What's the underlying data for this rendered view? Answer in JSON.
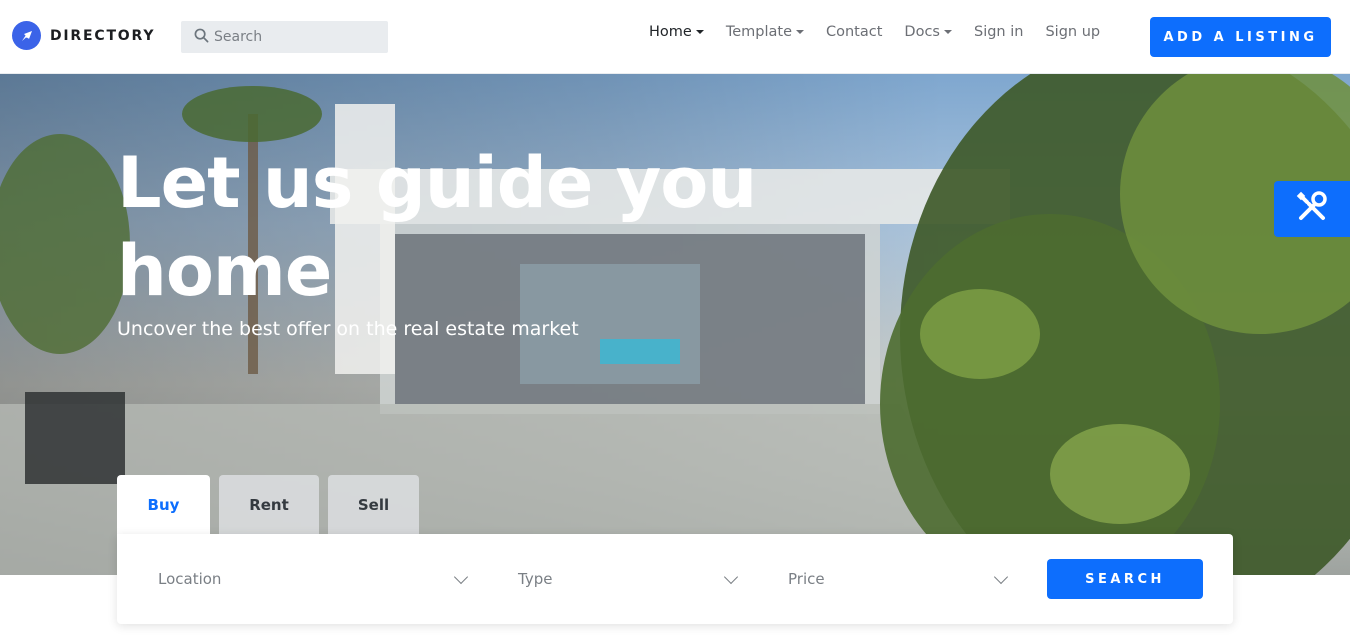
{
  "brand": {
    "name": "DIRECTORY",
    "icon": "compass-icon"
  },
  "search": {
    "placeholder": "Search",
    "icon": "search-icon"
  },
  "nav": {
    "items": [
      {
        "label": "Home",
        "dropdown": true,
        "active": true
      },
      {
        "label": "Template",
        "dropdown": true
      },
      {
        "label": "Contact",
        "dropdown": false
      },
      {
        "label": "Docs",
        "dropdown": true
      },
      {
        "label": "Sign in",
        "dropdown": false
      },
      {
        "label": "Sign up",
        "dropdown": false
      }
    ],
    "cta": "ADD A LISTING"
  },
  "hero": {
    "title": "Let us guide you home",
    "subtitle": "Uncover the best offer on the real estate market"
  },
  "tools": {
    "icon": "tools-icon"
  },
  "tabs": [
    {
      "label": "Buy",
      "active": true
    },
    {
      "label": "Rent"
    },
    {
      "label": "Sell"
    }
  ],
  "filters": {
    "location": "Location",
    "type": "Type",
    "price": "Price",
    "submit": "SEARCH"
  },
  "colors": {
    "primary": "#0d6efd",
    "brand_badge": "#3b63e8",
    "text_dark": "#212529",
    "text_muted": "#6c6f75"
  }
}
